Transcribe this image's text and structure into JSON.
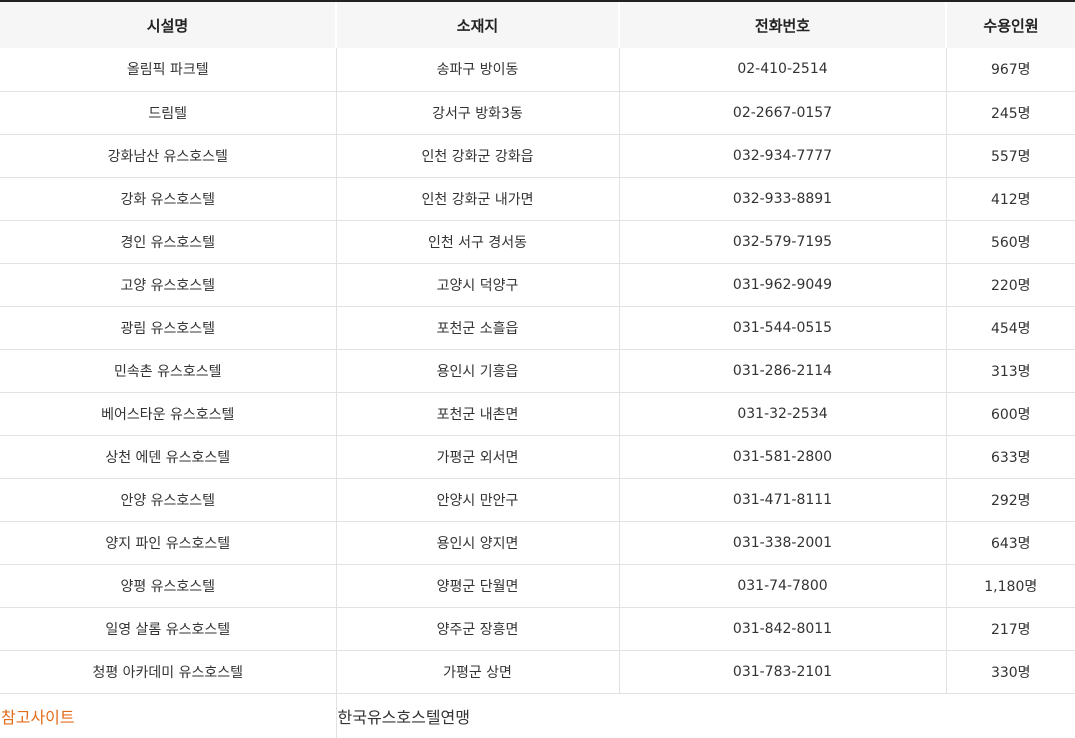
{
  "headers": [
    "시설명",
    "소재지",
    "전화번호",
    "수용인원"
  ],
  "rows": [
    [
      "올림픽 파크텔",
      "송파구 방이동",
      "02-410-2514",
      "967명"
    ],
    [
      "드림텔",
      "강서구 방화3동",
      "02-2667-0157",
      "245명"
    ],
    [
      "강화남산 유스호스텔",
      "인천 강화군 강화읍",
      "032-934-7777",
      "557명"
    ],
    [
      "강화 유스호스텔",
      "인천 강화군 내가면",
      "032-933-8891",
      "412명"
    ],
    [
      "경인 유스호스텔",
      "인천 서구 경서동",
      "032-579-7195",
      "560명"
    ],
    [
      "고양 유스호스텔",
      "고양시 덕양구",
      "031-962-9049",
      "220명"
    ],
    [
      "광림 유스호스텔",
      "포천군 소흘읍",
      "031-544-0515",
      "454명"
    ],
    [
      "민속촌 유스호스텔",
      "용인시 기흥읍",
      "031-286-2114",
      "313명"
    ],
    [
      "베어스타운 유스호스텔",
      "포천군 내촌면",
      "031-32-2534",
      "600명"
    ],
    [
      "상천 에덴 유스호스텔",
      "가평군 외서면",
      "031-581-2800",
      "633명"
    ],
    [
      "안양 유스호스텔",
      "안양시 만안구",
      "031-471-8111",
      "292명"
    ],
    [
      "양지 파인 유스호스텔",
      "용인시 양지면",
      "031-338-2001",
      "643명"
    ],
    [
      "양평 유스호스텔",
      "양평군 단월면",
      "031-74-7800",
      "1,180명"
    ],
    [
      "일영 살롬 유스호스텔",
      "양주군 장흥면",
      "031-842-8011",
      "217명"
    ],
    [
      "청평 아카데미 유스호스텔",
      "가평군 상면",
      "031-783-2101",
      "330명"
    ]
  ],
  "footer": {
    "label": "참고사이트",
    "value": "한국유스호스텔연맹"
  },
  "colors": {
    "link": "#e36c1b",
    "header_bg": "#f6f6f6",
    "border": "#e2e2e2",
    "top_rule": "#222222"
  }
}
